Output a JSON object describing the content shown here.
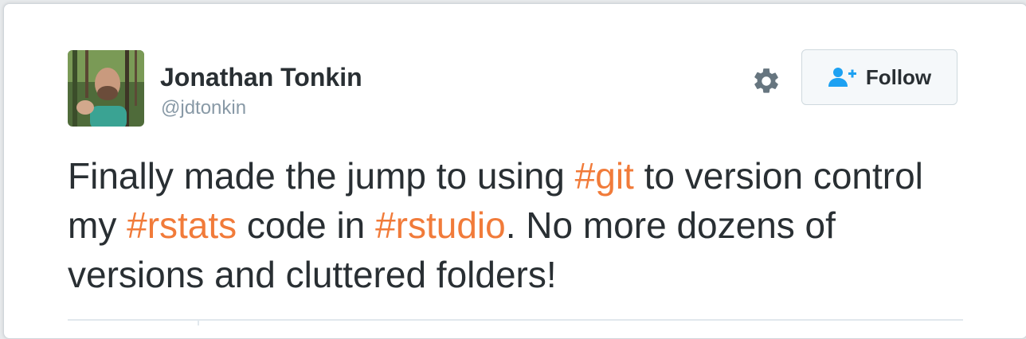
{
  "user": {
    "name": "Jonathan Tonkin",
    "handle": "@jdtonkin"
  },
  "actions": {
    "follow_label": "Follow",
    "gear_icon": "gear-icon",
    "follow_icon": "add-user-icon"
  },
  "tweet": {
    "p1": "Finally made the jump to using ",
    "tag1": "#git",
    "p2": " to version control my ",
    "tag2": "#rstats",
    "p3": " code in ",
    "tag3": "#rstudio",
    "p4": ". No more dozens of versions and cluttered folders!"
  },
  "colors": {
    "hashtag": "#f17b3a",
    "text": "#292f33",
    "muted": "#8899a6",
    "icon": "#66757f",
    "follow_icon": "#1da1f2"
  }
}
